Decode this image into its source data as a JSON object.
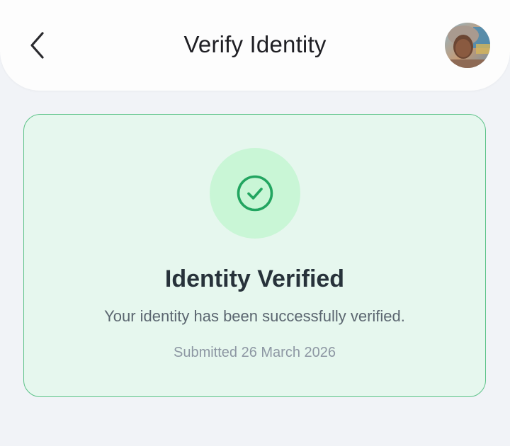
{
  "header": {
    "title": "Verify Identity",
    "back_icon": "chevron-left-icon",
    "avatar_label": "user-avatar"
  },
  "status_card": {
    "icon": "check-circle-icon",
    "title": "Identity Verified",
    "message": "Your identity has been successfully verified.",
    "submitted": "Submitted 26 March 2026"
  },
  "colors": {
    "background": "#f1f3f7",
    "header_bg": "#fdfdfd",
    "card_bg": "#e6f7ee",
    "card_border": "#5cc288",
    "icon_circle_bg": "#c9f6d6",
    "icon_stroke": "#22a560",
    "title_text": "#27323a",
    "message_text": "#5b6670",
    "muted_text": "#8d97a3"
  }
}
